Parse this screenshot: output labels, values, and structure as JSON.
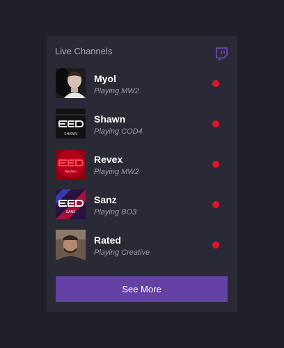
{
  "widget": {
    "title": "Live Channels",
    "brand_icon": "twitch-icon",
    "accent_color": "#6441a4",
    "live_color": "#e0132e"
  },
  "channels": [
    {
      "name": "Myol",
      "game": "Playing MW2",
      "avatar": "person-photo",
      "avatar_text": "",
      "status": "live"
    },
    {
      "name": "Shawn",
      "game": "Playing COD4",
      "avatar": "red-logo",
      "avatar_text": "SHAWN",
      "status": "live"
    },
    {
      "name": "Revex",
      "game": "Playing MW2",
      "avatar": "red-logo",
      "avatar_text": "REVEX",
      "status": "live"
    },
    {
      "name": "Sanz",
      "game": "Playing BO3",
      "avatar": "red-logo",
      "avatar_text": "SANZ",
      "status": "live"
    },
    {
      "name": "Rated",
      "game": "Playing Creative",
      "avatar": "person-photo",
      "avatar_text": "",
      "status": "live"
    }
  ],
  "footer": {
    "see_more_label": "See More"
  }
}
